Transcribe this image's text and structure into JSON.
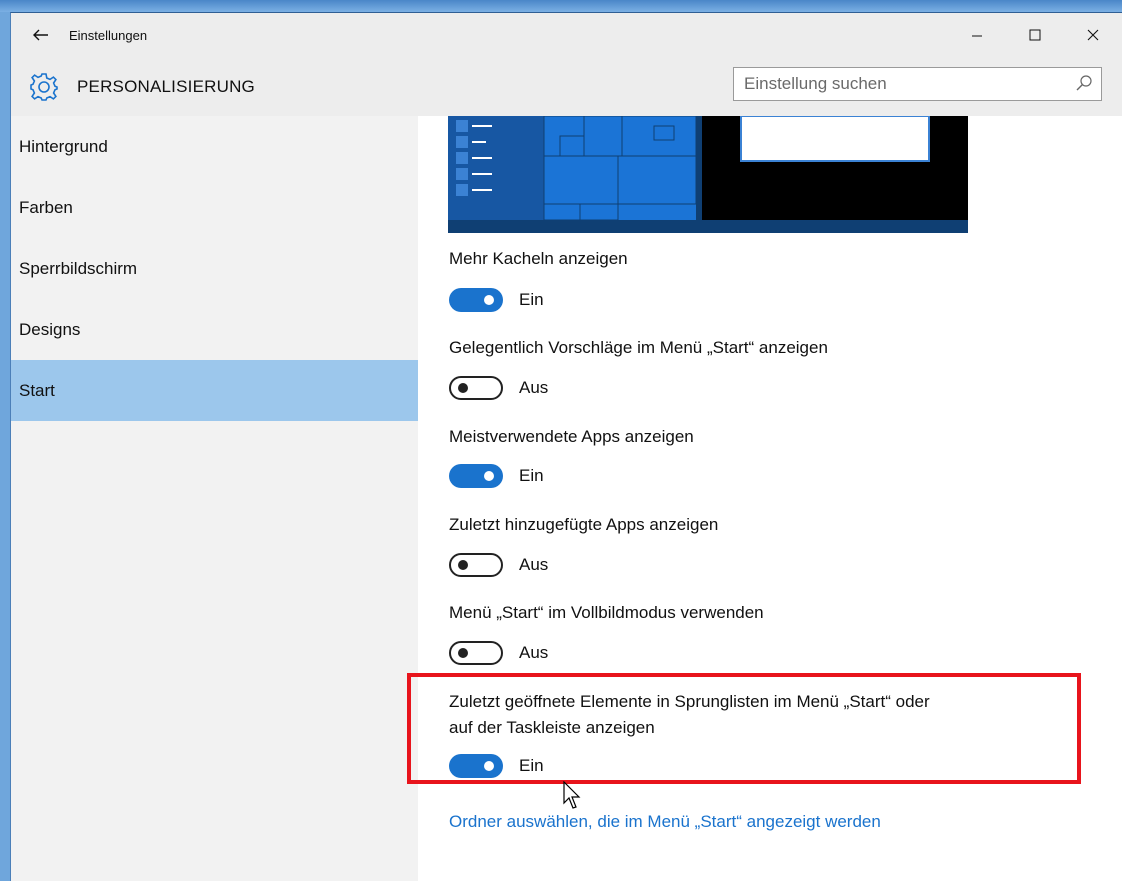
{
  "window": {
    "title": "Einstellungen",
    "back_icon": "back-arrow-icon",
    "controls": {
      "minimize": "—",
      "maximize": "☐",
      "close": "✕"
    }
  },
  "header": {
    "icon": "gear-icon",
    "title": "PERSONALISIERUNG",
    "search_placeholder": "Einstellung suchen"
  },
  "sidebar": {
    "items": [
      {
        "label": "Hintergrund",
        "active": false
      },
      {
        "label": "Farben",
        "active": false
      },
      {
        "label": "Sperrbildschirm",
        "active": false
      },
      {
        "label": "Designs",
        "active": false
      },
      {
        "label": "Start",
        "active": true
      }
    ]
  },
  "settings": [
    {
      "label": "Mehr Kacheln anzeigen",
      "state": "Ein"
    },
    {
      "label": "Gelegentlich Vorschläge im Menü „Start“ anzeigen",
      "state": "Aus"
    },
    {
      "label": "Meistverwendete Apps anzeigen",
      "state": "Ein"
    },
    {
      "label": "Zuletzt hinzugefügte Apps anzeigen",
      "state": "Aus"
    },
    {
      "label": "Menü „Start“ im Vollbildmodus verwenden",
      "state": "Aus"
    },
    {
      "label_line1": "Zuletzt geöffnete Elemente in Sprunglisten im Menü „Start“ oder",
      "label_line2": "auf der Taskleiste anzeigen",
      "state": "Ein"
    }
  ],
  "link": "Ordner auswählen, die im Menü „Start“ angezeigt werden",
  "colors": {
    "accent": "#1a73cd",
    "active_nav": "#9cc7ec",
    "highlight": "#e8141c"
  }
}
